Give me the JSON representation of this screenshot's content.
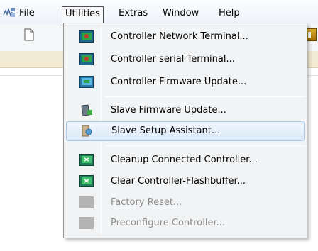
{
  "menubar": {
    "items": [
      {
        "label": "File"
      },
      {
        "label": "Utilities"
      },
      {
        "label": "Extras"
      },
      {
        "label": "Window"
      },
      {
        "label": "Help"
      }
    ]
  },
  "dropdown": {
    "items": [
      {
        "label": "Controller Network Terminal...",
        "icon": "network-terminal-icon"
      },
      {
        "label": "Controller serial Terminal...",
        "icon": "serial-terminal-icon"
      },
      {
        "label": "Controller Firmware Update...",
        "icon": "firmware-update-icon"
      },
      {
        "label": "Slave Firmware Update...",
        "icon": "slave-firmware-icon"
      },
      {
        "label": "Slave Setup Assistant...",
        "icon": "setup-assistant-icon"
      },
      {
        "label": "Cleanup Connected Controller...",
        "icon": "cleanup-icon"
      },
      {
        "label": "Clear Controller-Flashbuffer...",
        "icon": "clear-flash-icon"
      },
      {
        "label": "Factory Reset...",
        "icon": "factory-reset-icon"
      },
      {
        "label": "Preconfigure Controller...",
        "icon": "preconfigure-icon"
      }
    ]
  },
  "colors": {
    "highlight_border": "#a8c8ec",
    "band": "#f3ead3",
    "disabled_text": "#8d8d8d"
  }
}
